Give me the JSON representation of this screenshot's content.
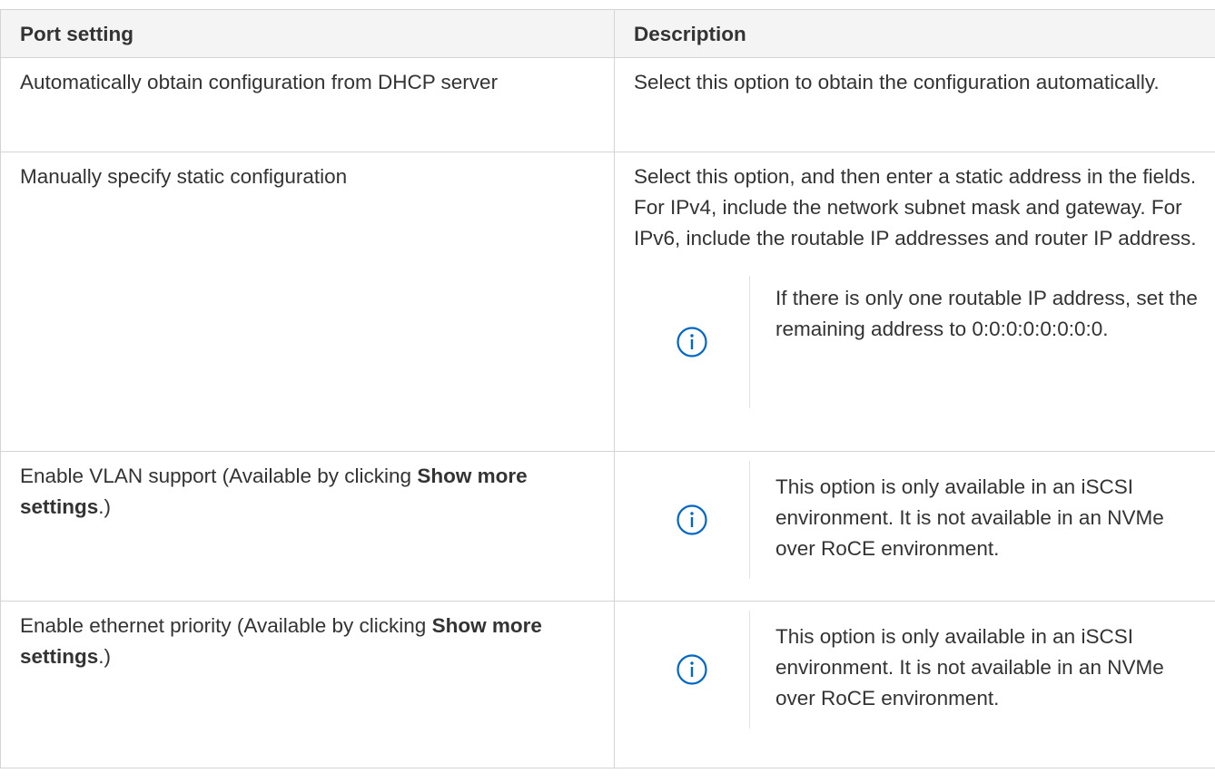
{
  "table": {
    "headers": {
      "col1": "Port setting",
      "col2": "Description"
    },
    "rows": [
      {
        "setting": "Automatically obtain configuration from DHCP server",
        "description": "Select this option to obtain the configuration automatically."
      },
      {
        "setting": "Manually specify static configuration",
        "description": "Select this option, and then enter a static address in the fields. For IPv4, include the network subnet mask and gateway. For IPv6, include the routable IP addresses and router IP address.",
        "note": "If there is only one routable IP address, set the remaining address to 0:0:0:0:0:0:0:0.",
        "note_icon": "info-icon"
      },
      {
        "setting_prefix": "Enable VLAN support (Available by clicking ",
        "setting_bold": "Show more settings",
        "setting_suffix": ".)",
        "note": "This option is only available in an iSCSI environment. It is not available in an NVMe over RoCE environment.",
        "note_icon": "info-icon"
      },
      {
        "setting_prefix": "Enable ethernet priority (Available by clicking ",
        "setting_bold": "Show more settings",
        "setting_suffix": ".)",
        "note": "This option is only available in an iSCSI environment. It is not available in an NVMe over RoCE environment.",
        "note_icon": "info-icon"
      }
    ]
  },
  "colors": {
    "text": "#333333",
    "header_bg": "#f4f4f4",
    "border": "#d4d4d4",
    "icon": "#0067c5"
  }
}
